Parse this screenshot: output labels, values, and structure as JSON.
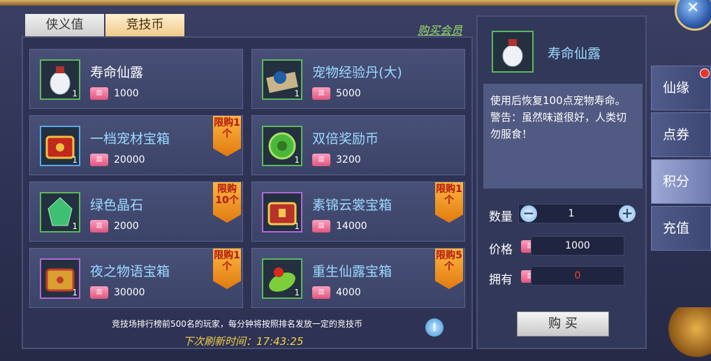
{
  "tabs": [
    "侠义值",
    "竞技币"
  ],
  "buy_vip": "购买会员",
  "currency_icon_text": "皿",
  "items": [
    {
      "name": "寿命仙露",
      "price": "1000",
      "qty": "1",
      "limit": "",
      "border": "green",
      "icon": "potion-bottle-icon"
    },
    {
      "name": "宠物经验丹(大)",
      "price": "5000",
      "qty": "1",
      "limit": "",
      "border": "green",
      "icon": "exp-pill-icon"
    },
    {
      "name": "一档宠材宝箱",
      "price": "20000",
      "qty": "1",
      "limit": "限购1个",
      "border": "blue",
      "icon": "treasure-chest-icon"
    },
    {
      "name": "双倍奖励币",
      "price": "3200",
      "qty": "1",
      "limit": "",
      "border": "green",
      "icon": "jade-coin-icon"
    },
    {
      "name": "绿色晶石",
      "price": "2000",
      "qty": "1",
      "limit": "限购10个",
      "border": "green",
      "icon": "green-crystal-icon"
    },
    {
      "name": "素锦云裳宝箱",
      "price": "14000",
      "qty": "1",
      "limit": "限购1个",
      "border": "purple",
      "icon": "treasure-chest-icon"
    },
    {
      "name": "夜之物语宝箱",
      "price": "30000",
      "qty": "1",
      "limit": "限购1个",
      "border": "purple",
      "icon": "treasure-chest-icon"
    },
    {
      "name": "重生仙露宝箱",
      "price": "4000",
      "qty": "1",
      "limit": "限购5个",
      "border": "green",
      "icon": "leaf-orb-icon"
    }
  ],
  "tip": "竞技场排行榜前500名的玩家，每分钟将按照排名发放一定的竞技币",
  "refresh": "下次刷新时间：17:43:25",
  "detail": {
    "name": "寿命仙露",
    "description": "使用后恢复100点宠物寿命。警告：虽然味道很好，人类切勿服食！",
    "labels": {
      "quantity": "数量",
      "price": "价格",
      "owned": "拥有"
    },
    "quantity": "1",
    "price": "1000",
    "owned": "0",
    "buy_button": "购 买"
  },
  "side_tabs": [
    "仙缘",
    "点券",
    "积分",
    "充值"
  ],
  "colors": {
    "limit_badge": "#f0a030",
    "owned_value": "#ff3b30",
    "accent_name": "#9cd9ff"
  }
}
